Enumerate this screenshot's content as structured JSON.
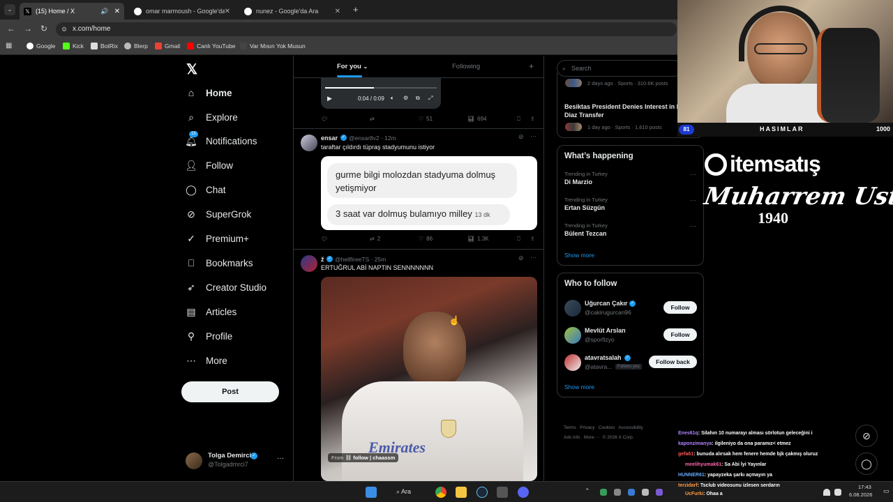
{
  "browser": {
    "tabs": [
      {
        "title": "(15) Home / X",
        "active": true
      },
      {
        "title": "omar marmoush - Google'da Ara",
        "active": false
      },
      {
        "title": "nunez - Google'da Ara",
        "active": false
      }
    ],
    "url": "x.com/home",
    "bookmarks": [
      "Google",
      "Kick",
      "BotRix",
      "Blerp",
      "Gmail",
      "Canlı YouTube",
      "Var Mısın Yok Musun"
    ]
  },
  "sidebar": {
    "items": [
      {
        "label": "Home",
        "icon": "home-icon"
      },
      {
        "label": "Explore",
        "icon": "search-icon"
      },
      {
        "label": "Notifications",
        "icon": "bell-icon",
        "badge": "15"
      },
      {
        "label": "Follow",
        "icon": "person-plus-icon"
      },
      {
        "label": "Chat",
        "icon": "chat-icon"
      },
      {
        "label": "SuperGrok",
        "icon": "grok-icon"
      },
      {
        "label": "Premium+",
        "icon": "verified-icon"
      },
      {
        "label": "Bookmarks",
        "icon": "bookmark-icon"
      },
      {
        "label": "Creator Studio",
        "icon": "rocket-icon"
      },
      {
        "label": "Articles",
        "icon": "article-icon"
      },
      {
        "label": "Profile",
        "icon": "person-icon"
      },
      {
        "label": "More",
        "icon": "more-circle-icon"
      }
    ],
    "post_label": "Post",
    "user": {
      "name": "Tolga Demirci",
      "handle": "@Tolgadmrci7"
    }
  },
  "feed": {
    "tabs": [
      "For you",
      "Following"
    ],
    "video1": {
      "time": "0:04 / 0:09",
      "actions": {
        "likes": "51",
        "views": "694"
      }
    },
    "tweet1": {
      "name": "ensar",
      "handle": "@ensar8v2 · 12m",
      "text": "taraftar çıldırdı tüpraş stadyumunu istiyor",
      "msg1": "gurme bilgi molozdan stadyuma dolmuş yetişmiyor",
      "msg2": "3 saat var dolmuş bulamıyo milley",
      "msg2_time": "13 dk",
      "retweets": "2",
      "likes": "86",
      "views": "1.3K"
    },
    "tweet2": {
      "name": "ž",
      "handle": "@hellfireeTS · 25m",
      "text": "ERTUĞRUL ABİ NAPTIN SENNNNNNN",
      "from_label": "From",
      "from_source": "follow | chaassm",
      "jersey": "Emirates"
    }
  },
  "right": {
    "search_placeholder": "Search",
    "top_news": [
      {
        "meta": "2 days ago · Sports · 310.6K posts"
      },
      {
        "title": "Besiktas President Denies Interest in Brahim Diaz Transfer",
        "meta": "1 day ago · Sports · 1,610 posts"
      }
    ],
    "whats_happening": "What’s happening",
    "trends": [
      {
        "context": "Trending in Turkey",
        "name": "Di Marzio"
      },
      {
        "context": "Trending in Turkey",
        "name": "Ertan Süzgün"
      },
      {
        "context": "Trending in Turkey",
        "name": "Bülent Tezcan"
      }
    ],
    "show_more": "Show more",
    "who_to_follow": "Who to follow",
    "suggestions": [
      {
        "name": "Uğurcan Çakır",
        "handle": "@cakirugurcan96",
        "action": "Follow"
      },
      {
        "name": "Mevlüt Arslan",
        "handle": "@sporfizyo",
        "action": "Follow"
      },
      {
        "name": "atavratsalah",
        "handle": "@atavra...",
        "tag": "Follows you",
        "action": "Follow back"
      }
    ],
    "footer": [
      "Terms",
      "Privacy",
      "Cookies",
      "Accessibility",
      "Ads info",
      "More ···",
      "© 2026 X Corp."
    ]
  },
  "overlay": {
    "hasimlar": "HASIMLAR",
    "score_left": "81",
    "score_right": "1000",
    "sponsor": "itemsatış",
    "signature": "Muharrem Usta",
    "year": "1940",
    "chat": [
      {
        "user": "Enes61q",
        "color": "#b084ff",
        "msg": ": Silahın 10 numarayı alması sörlotun geleceğini i"
      },
      {
        "user": "kaponzimanya",
        "color": "#b084ff",
        "msg": ": ilgileniyo da ona paramız< etmez"
      },
      {
        "user": "gefa61",
        "color": "#ff5555",
        "msg": ": bunuda alırsak hem fenere hemde bjk çakmış oluruz"
      },
      {
        "user": "meelihyumak61",
        "color": "#ff66aa",
        "msg": ": Sa Abi İyi Yayınlar"
      },
      {
        "user": "HUNNER61",
        "color": "#66aaff",
        "msg": ": yapayzeka şarkı açmayın ya"
      },
      {
        "user": "terzidarf",
        "color": "#ff9944",
        "msg": ": Tsclub videosunu izlesen serdarın"
      },
      {
        "user": "UcFurki",
        "color": "#ff9944",
        "msg": ": Ohaa a"
      }
    ]
  },
  "taskbar": {
    "search_label": "Ara",
    "time": "17:43",
    "date": "6.08.2026"
  }
}
